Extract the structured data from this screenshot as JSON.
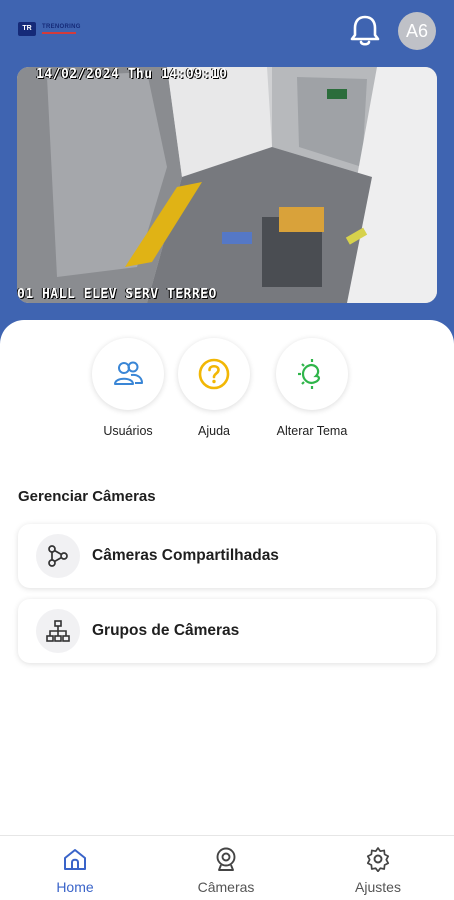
{
  "brand": {
    "logo_mark": "TR",
    "logo_text": "TRENORING"
  },
  "header": {
    "avatar_initials": "A6"
  },
  "camera_feed": {
    "timestamp": "14/02/2024 Thu 14:09:10",
    "camera_name": "01 HALL ELEV SERV TERREO"
  },
  "quick_actions": [
    {
      "label": "Usuários",
      "icon": "users-icon"
    },
    {
      "label": "Ajuda",
      "icon": "help-icon"
    },
    {
      "label": "Alterar Tema",
      "icon": "theme-icon"
    }
  ],
  "manage": {
    "title": "Gerenciar Câmeras",
    "items": [
      {
        "label": "Câmeras Compartilhadas",
        "icon": "share-icon"
      },
      {
        "label": "Grupos de Câmeras",
        "icon": "hierarchy-icon"
      }
    ]
  },
  "nav": {
    "items": [
      {
        "label": "Home",
        "icon": "home-icon",
        "active": true
      },
      {
        "label": "Câmeras",
        "icon": "webcam-icon",
        "active": false
      },
      {
        "label": "Ajustes",
        "icon": "settings-icon",
        "active": false
      }
    ]
  },
  "colors": {
    "header_bg": "#3f64b1",
    "accent": "#3a64c9",
    "help_yellow": "#f2b705",
    "theme_green": "#2fb54a"
  }
}
